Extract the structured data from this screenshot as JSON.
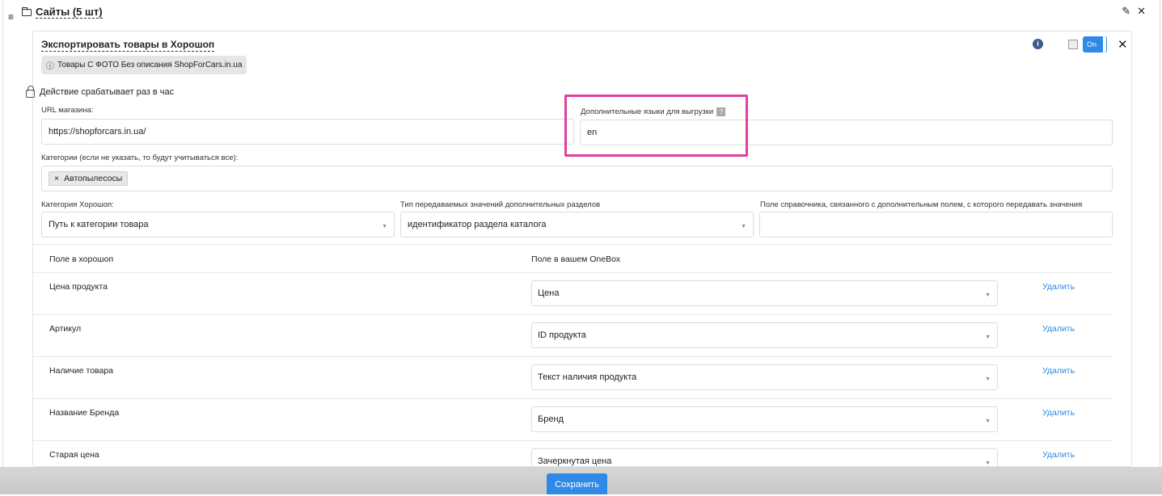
{
  "header": {
    "title": "Сайты (5 шт)",
    "edit_icon": "pencil-icon",
    "close_icon": "close-icon"
  },
  "card": {
    "title": "Экспортировать товары в Хорошоп",
    "tag_text": "Товары С ФОТО Без описания ShopForCars.in.ua",
    "toggle_label": "On",
    "close_label": "✕"
  },
  "trigger_text": "Действие срабатывает раз в час",
  "fields": {
    "url_label": "URL магазина:",
    "url_value": "https://shopforcars.in.ua/",
    "langs_label": "Дополнительные языки для выгрузки",
    "langs_help": "?",
    "langs_value": "en",
    "categories_label": "Категории (если не указать, то будут учитываться все):",
    "category_chip": "Автопылесосы",
    "chip_remove": "×",
    "horoshop_category_label": "Категория Хорошоп:",
    "horoshop_category_value": "Путь к категории товара",
    "value_type_label": "Тип передаваемых значений дополнительных разделов",
    "value_type_value": "идентификатор раздела каталога",
    "directory_field_label": "Поле справочника, связанного с дополнительным полем, с которого передавать значения",
    "directory_field_value": ""
  },
  "mapping": {
    "col_left": "Поле в хорошоп",
    "col_right": "Поле в вашем OneBox",
    "delete_label": "Удалить",
    "rows": [
      {
        "name": "Цена продукта",
        "value": "Цена"
      },
      {
        "name": "Артикул",
        "value": "ID продукта"
      },
      {
        "name": "Наличие товара",
        "value": "Текст наличия продукта"
      },
      {
        "name": "Название Бренда",
        "value": "Бренд"
      },
      {
        "name": "Старая цена",
        "value": "Зачеркнутая цена"
      }
    ]
  },
  "save_label": "Сохранить",
  "colors": {
    "accent": "#2e8ae6",
    "highlight": "#e040a0"
  }
}
